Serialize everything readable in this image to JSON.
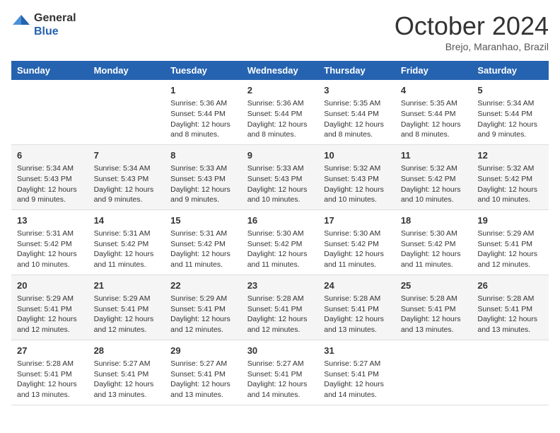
{
  "logo": {
    "line1": "General",
    "line2": "Blue"
  },
  "title": "October 2024",
  "subtitle": "Brejo, Maranhao, Brazil",
  "days_of_week": [
    "Sunday",
    "Monday",
    "Tuesday",
    "Wednesday",
    "Thursday",
    "Friday",
    "Saturday"
  ],
  "weeks": [
    [
      null,
      null,
      {
        "day": "1",
        "sunrise": "5:36 AM",
        "sunset": "5:44 PM",
        "daylight": "12 hours and 8 minutes."
      },
      {
        "day": "2",
        "sunrise": "5:36 AM",
        "sunset": "5:44 PM",
        "daylight": "12 hours and 8 minutes."
      },
      {
        "day": "3",
        "sunrise": "5:35 AM",
        "sunset": "5:44 PM",
        "daylight": "12 hours and 8 minutes."
      },
      {
        "day": "4",
        "sunrise": "5:35 AM",
        "sunset": "5:44 PM",
        "daylight": "12 hours and 8 minutes."
      },
      {
        "day": "5",
        "sunrise": "5:34 AM",
        "sunset": "5:44 PM",
        "daylight": "12 hours and 9 minutes."
      }
    ],
    [
      {
        "day": "6",
        "sunrise": "5:34 AM",
        "sunset": "5:43 PM",
        "daylight": "12 hours and 9 minutes."
      },
      {
        "day": "7",
        "sunrise": "5:34 AM",
        "sunset": "5:43 PM",
        "daylight": "12 hours and 9 minutes."
      },
      {
        "day": "8",
        "sunrise": "5:33 AM",
        "sunset": "5:43 PM",
        "daylight": "12 hours and 9 minutes."
      },
      {
        "day": "9",
        "sunrise": "5:33 AM",
        "sunset": "5:43 PM",
        "daylight": "12 hours and 10 minutes."
      },
      {
        "day": "10",
        "sunrise": "5:32 AM",
        "sunset": "5:43 PM",
        "daylight": "12 hours and 10 minutes."
      },
      {
        "day": "11",
        "sunrise": "5:32 AM",
        "sunset": "5:42 PM",
        "daylight": "12 hours and 10 minutes."
      },
      {
        "day": "12",
        "sunrise": "5:32 AM",
        "sunset": "5:42 PM",
        "daylight": "12 hours and 10 minutes."
      }
    ],
    [
      {
        "day": "13",
        "sunrise": "5:31 AM",
        "sunset": "5:42 PM",
        "daylight": "12 hours and 10 minutes."
      },
      {
        "day": "14",
        "sunrise": "5:31 AM",
        "sunset": "5:42 PM",
        "daylight": "12 hours and 11 minutes."
      },
      {
        "day": "15",
        "sunrise": "5:31 AM",
        "sunset": "5:42 PM",
        "daylight": "12 hours and 11 minutes."
      },
      {
        "day": "16",
        "sunrise": "5:30 AM",
        "sunset": "5:42 PM",
        "daylight": "12 hours and 11 minutes."
      },
      {
        "day": "17",
        "sunrise": "5:30 AM",
        "sunset": "5:42 PM",
        "daylight": "12 hours and 11 minutes."
      },
      {
        "day": "18",
        "sunrise": "5:30 AM",
        "sunset": "5:42 PM",
        "daylight": "12 hours and 11 minutes."
      },
      {
        "day": "19",
        "sunrise": "5:29 AM",
        "sunset": "5:41 PM",
        "daylight": "12 hours and 12 minutes."
      }
    ],
    [
      {
        "day": "20",
        "sunrise": "5:29 AM",
        "sunset": "5:41 PM",
        "daylight": "12 hours and 12 minutes."
      },
      {
        "day": "21",
        "sunrise": "5:29 AM",
        "sunset": "5:41 PM",
        "daylight": "12 hours and 12 minutes."
      },
      {
        "day": "22",
        "sunrise": "5:29 AM",
        "sunset": "5:41 PM",
        "daylight": "12 hours and 12 minutes."
      },
      {
        "day": "23",
        "sunrise": "5:28 AM",
        "sunset": "5:41 PM",
        "daylight": "12 hours and 12 minutes."
      },
      {
        "day": "24",
        "sunrise": "5:28 AM",
        "sunset": "5:41 PM",
        "daylight": "12 hours and 13 minutes."
      },
      {
        "day": "25",
        "sunrise": "5:28 AM",
        "sunset": "5:41 PM",
        "daylight": "12 hours and 13 minutes."
      },
      {
        "day": "26",
        "sunrise": "5:28 AM",
        "sunset": "5:41 PM",
        "daylight": "12 hours and 13 minutes."
      }
    ],
    [
      {
        "day": "27",
        "sunrise": "5:28 AM",
        "sunset": "5:41 PM",
        "daylight": "12 hours and 13 minutes."
      },
      {
        "day": "28",
        "sunrise": "5:27 AM",
        "sunset": "5:41 PM",
        "daylight": "12 hours and 13 minutes."
      },
      {
        "day": "29",
        "sunrise": "5:27 AM",
        "sunset": "5:41 PM",
        "daylight": "12 hours and 13 minutes."
      },
      {
        "day": "30",
        "sunrise": "5:27 AM",
        "sunset": "5:41 PM",
        "daylight": "12 hours and 14 minutes."
      },
      {
        "day": "31",
        "sunrise": "5:27 AM",
        "sunset": "5:41 PM",
        "daylight": "12 hours and 14 minutes."
      },
      null,
      null
    ]
  ],
  "labels": {
    "sunrise": "Sunrise:",
    "sunset": "Sunset:",
    "daylight": "Daylight:"
  },
  "colors": {
    "header_bg": "#2563b0",
    "header_text": "#ffffff",
    "odd_row": "#ffffff",
    "even_row": "#f5f5f5"
  }
}
